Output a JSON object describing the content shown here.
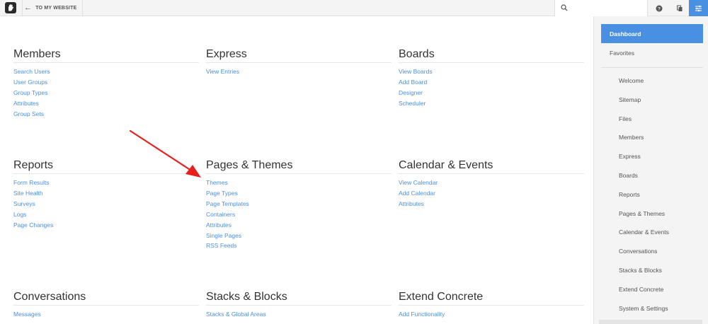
{
  "header": {
    "back_label": "TO MY WEBSITE",
    "search_placeholder": "",
    "icons": [
      "logo-icon",
      "help-icon",
      "clipboard-icon",
      "sliders-icon"
    ],
    "accent": "#4a90e2"
  },
  "sections": {
    "members": {
      "title": "Members",
      "links": [
        "Search Users",
        "User Groups",
        "Group Types",
        "Attributes",
        "Group Sets"
      ]
    },
    "express": {
      "title": "Express",
      "links": [
        "View Entries"
      ]
    },
    "boards": {
      "title": "Boards",
      "links": [
        "View Boards",
        "Add Board",
        "Designer",
        "Scheduler"
      ]
    },
    "reports": {
      "title": "Reports",
      "links": [
        "Form Results",
        "Site Health",
        "Surveys",
        "Logs",
        "Page Changes"
      ]
    },
    "pages_themes": {
      "title": "Pages & Themes",
      "links": [
        "Themes",
        "Page Types",
        "Page Templates",
        "Containers",
        "Attributes",
        "Single Pages",
        "RSS Feeds"
      ]
    },
    "calendar": {
      "title": "Calendar & Events",
      "links": [
        "View Calendar",
        "Add Calendar",
        "Attributes"
      ]
    },
    "conversations": {
      "title": "Conversations",
      "links": [
        "Messages"
      ]
    },
    "stacks": {
      "title": "Stacks & Blocks",
      "links": [
        "Stacks & Global Areas"
      ]
    },
    "extend": {
      "title": "Extend Concrete",
      "links": [
        "Add Functionality"
      ]
    }
  },
  "sidebar": {
    "dashboard": "Dashboard",
    "favorites": "Favorites",
    "items": [
      "Welcome",
      "Sitemap",
      "Files",
      "Members",
      "Express",
      "Boards",
      "Reports",
      "Pages & Themes",
      "Calendar & Events",
      "Conversations",
      "Stacks & Blocks",
      "Extend Concrete",
      "System & Settings"
    ]
  }
}
